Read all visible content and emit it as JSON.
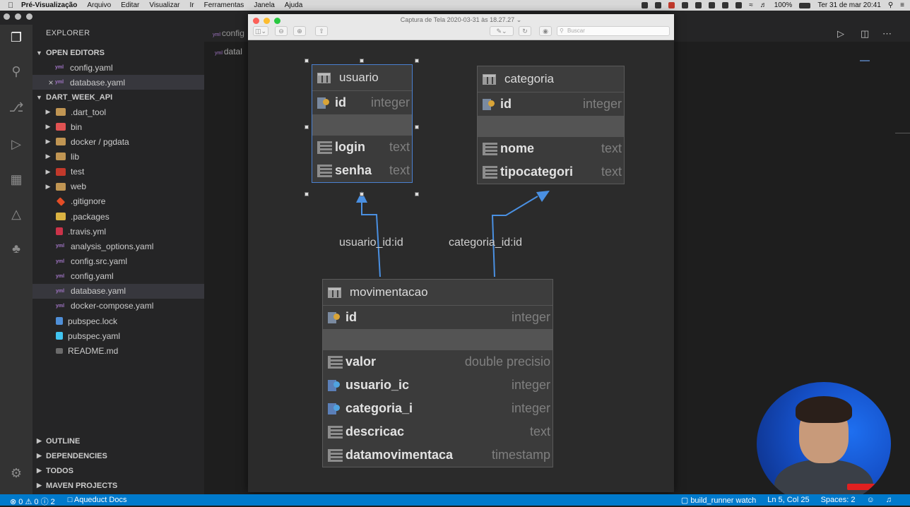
{
  "menubar": {
    "app": "Pré-Visualização",
    "items": [
      "Arquivo",
      "Editar",
      "Visualizar",
      "Ir",
      "Ferramentas",
      "Janela",
      "Ajuda"
    ],
    "battery": "100%",
    "datetime": "Ter 31 de mar  20:41"
  },
  "sidebar": {
    "title": "EXPLORER",
    "open_editors_label": "OPEN EDITORS",
    "open_editors": [
      "config.yaml",
      "database.yaml"
    ],
    "project_label": "DART_WEEK_API",
    "tree": [
      {
        "label": ".dart_tool",
        "kind": "folder"
      },
      {
        "label": "bin",
        "kind": "bin"
      },
      {
        "label": "docker / pgdata",
        "kind": "folder"
      },
      {
        "label": "lib",
        "kind": "folder"
      },
      {
        "label": "test",
        "kind": "test"
      },
      {
        "label": "web",
        "kind": "folder"
      },
      {
        "label": ".gitignore",
        "kind": "git"
      },
      {
        "label": ".packages",
        "kind": "pkg"
      },
      {
        "label": ".travis.yml",
        "kind": "travis"
      },
      {
        "label": "analysis_options.yaml",
        "kind": "yaml"
      },
      {
        "label": "config.src.yaml",
        "kind": "yaml"
      },
      {
        "label": "config.yaml",
        "kind": "yaml"
      },
      {
        "label": "database.yaml",
        "kind": "yaml"
      },
      {
        "label": "docker-compose.yaml",
        "kind": "yaml"
      },
      {
        "label": "pubspec.lock",
        "kind": "lock"
      },
      {
        "label": "pubspec.yaml",
        "kind": "pub"
      },
      {
        "label": "README.md",
        "kind": "readme"
      }
    ],
    "bottom_sections": [
      "OUTLINE",
      "DEPENDENCIES",
      "TODOS",
      "MAVEN PROJECTS"
    ]
  },
  "editor": {
    "tab_partial": "config",
    "breadcrumb_partial": "datal"
  },
  "statusbar": {
    "errors": "0",
    "warnings": "0",
    "info": "2",
    "docs": "Aqueduct Docs",
    "task": "build_runner watch",
    "position": "Ln 5, Col 25",
    "spaces": "Spaces: 2"
  },
  "preview": {
    "title": "Captura de Tela 2020-03-31 às 18.27.27",
    "search_placeholder": "Buscar"
  },
  "diagram": {
    "tables": {
      "usuario": {
        "name": "usuario",
        "pk": {
          "name": "id",
          "type": "integer"
        },
        "cols": [
          {
            "name": "login",
            "type": "text"
          },
          {
            "name": "senha",
            "type": "text"
          }
        ]
      },
      "categoria": {
        "name": "categoria",
        "pk": {
          "name": "id",
          "type": "integer"
        },
        "cols": [
          {
            "name": "nome",
            "type": "text"
          },
          {
            "name": "tipocategori",
            "type": "text"
          }
        ]
      },
      "movimentacao": {
        "name": "movimentacao",
        "pk": {
          "name": "id",
          "type": "integer"
        },
        "cols": [
          {
            "name": "valor",
            "type": "double precisio",
            "fk": false
          },
          {
            "name": "usuario_ic",
            "type": "integer",
            "fk": true
          },
          {
            "name": "categoria_i",
            "type": "integer",
            "fk": true
          },
          {
            "name": "descricac",
            "type": "text",
            "fk": false
          },
          {
            "name": "datamovimentaca",
            "type": "timestamp",
            "fk": false
          }
        ]
      }
    },
    "edges": [
      "usuario_id:id",
      "categoria_id:id"
    ]
  },
  "colors": {
    "accent": "#007acc",
    "arrow": "#4a90e2"
  }
}
